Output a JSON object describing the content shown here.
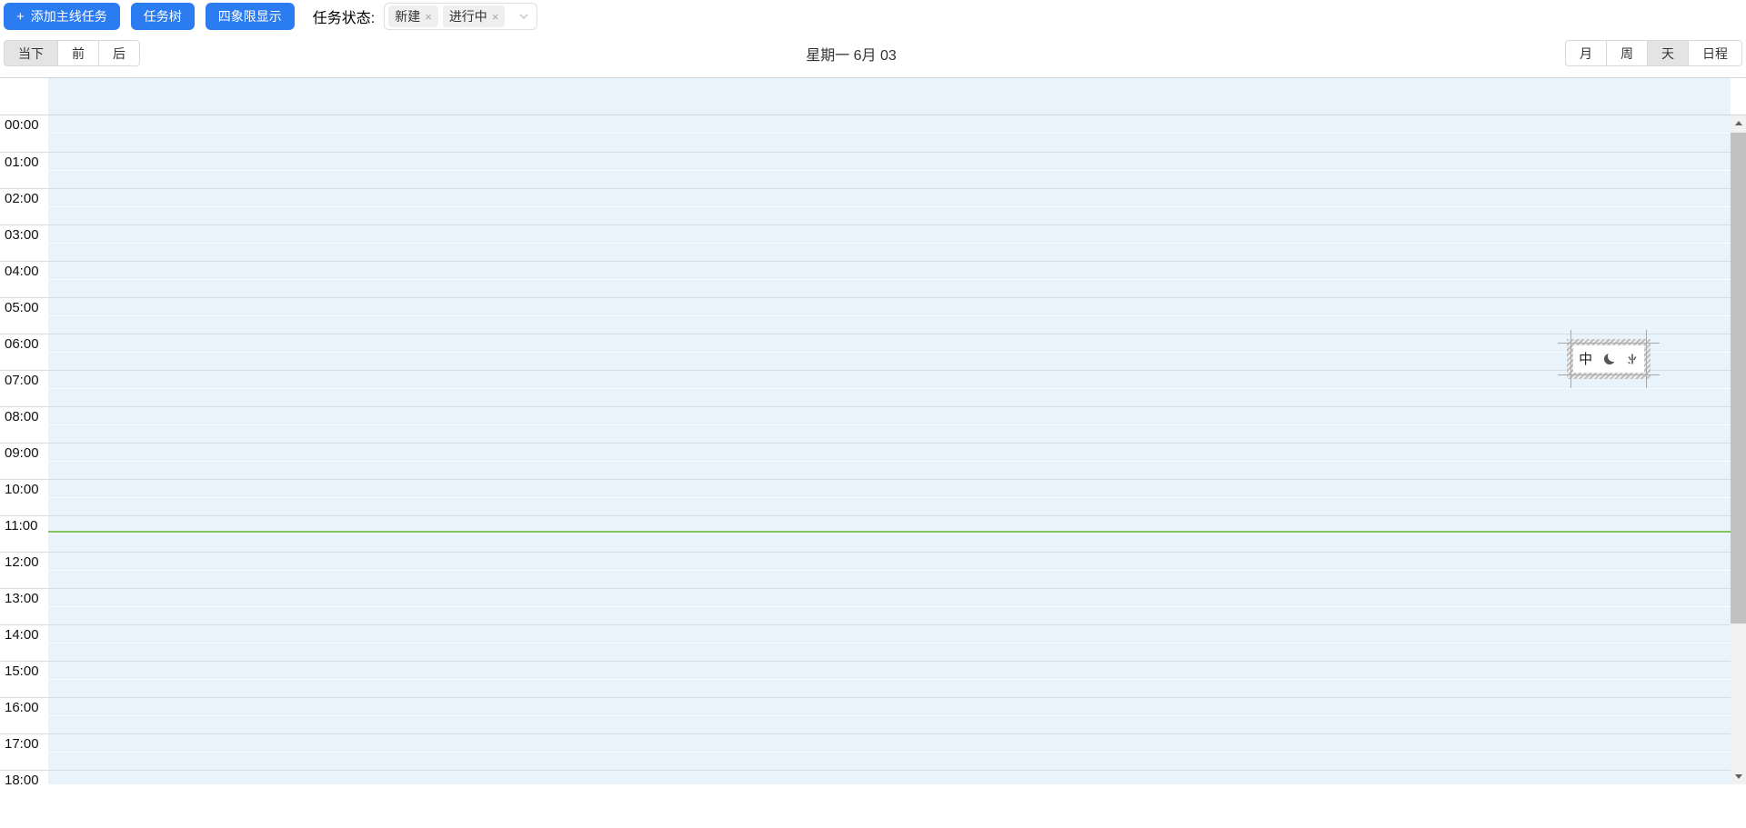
{
  "toolbar": {
    "add_icon": "+",
    "buttons": {
      "add_main_task": "添加主线任务",
      "task_tree": "任务树",
      "quadrant_display": "四象限显示"
    },
    "status_filter": {
      "label": "任务状态:",
      "tags": [
        {
          "label": "新建",
          "remove_icon": "×"
        },
        {
          "label": "进行中",
          "remove_icon": "×"
        }
      ]
    }
  },
  "calendar_header": {
    "nav": {
      "today": "当下",
      "prev": "前",
      "next": "后"
    },
    "title": "星期一 6月 03",
    "views": [
      {
        "label": "月",
        "active": false
      },
      {
        "label": "周",
        "active": false
      },
      {
        "label": "天",
        "active": true
      },
      {
        "label": "日程",
        "active": false
      }
    ]
  },
  "time_grid": {
    "hours": [
      "00:00",
      "01:00",
      "02:00",
      "03:00",
      "04:00",
      "05:00",
      "06:00",
      "07:00",
      "08:00",
      "09:00",
      "10:00",
      "11:00",
      "12:00",
      "13:00",
      "14:00",
      "15:00",
      "16:00",
      "17:00",
      "18:00"
    ]
  },
  "ime_toolbar": {
    "chinese_mode": "中",
    "icons": [
      "chinese-mode-icon",
      "fullwidth-moon-icon",
      "punctuation-icon"
    ]
  },
  "colors": {
    "primary_button": "#2b7cf0",
    "grid_background": "#e8f3fc",
    "hour_line": "#d8dce0",
    "current_time_line": "#85c35e",
    "selected_button_bg": "#e4e4e4",
    "scrollbar_thumb": "#c1c1c1"
  }
}
